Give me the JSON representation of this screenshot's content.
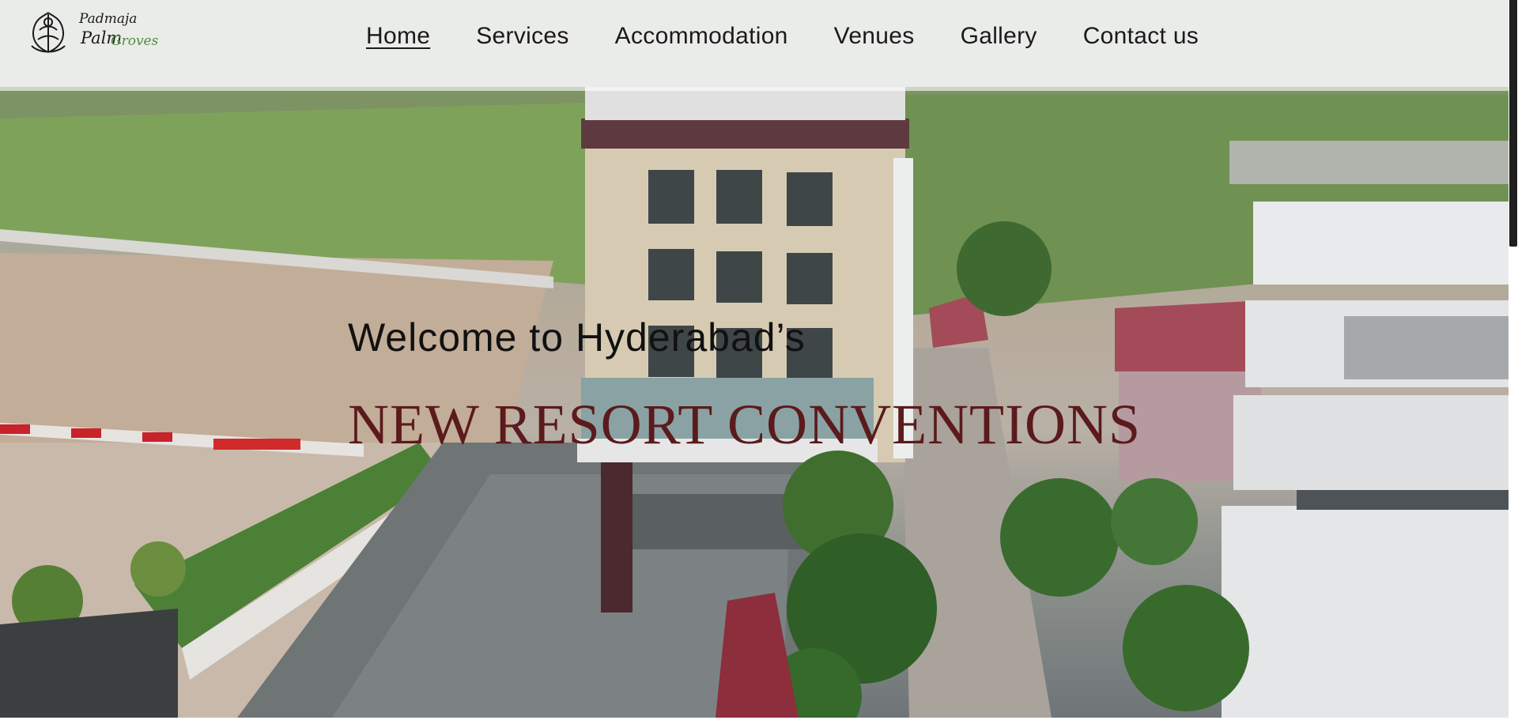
{
  "brand": {
    "logo_line1": "Padmaja",
    "logo_line2": "Palm",
    "logo_line3": "Groves",
    "icon": "palm-ornament-icon"
  },
  "nav": {
    "items": [
      {
        "label": "Home",
        "active": true
      },
      {
        "label": "Services",
        "active": false
      },
      {
        "label": "Accommodation",
        "active": false
      },
      {
        "label": "Venues",
        "active": false
      },
      {
        "label": "Gallery",
        "active": false
      },
      {
        "label": "Contact us",
        "active": false
      }
    ]
  },
  "hero": {
    "welcome": "Welcome to Hyderabad’s",
    "headline": "NEW RESORT CONVENTIONS"
  },
  "colors": {
    "headline": "#5b1a1c",
    "text": "#111111",
    "accent_green": "#4f8d43",
    "nav_overlay": "rgba(255,255,255,0.62)"
  }
}
